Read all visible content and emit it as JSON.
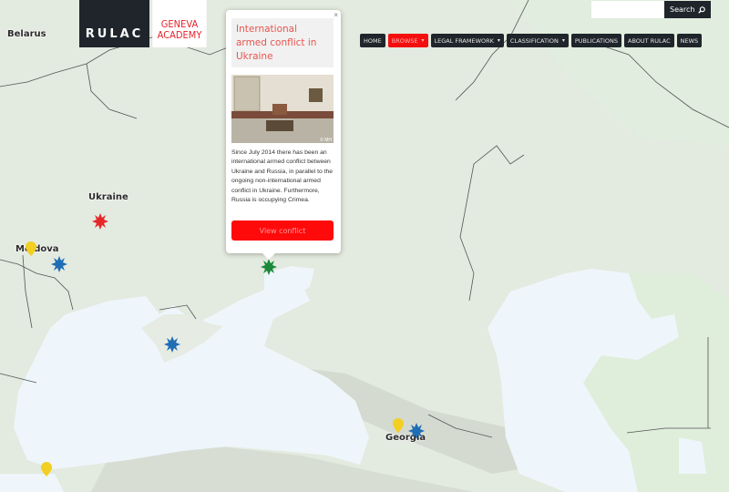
{
  "header": {
    "logo_primary": "RULAC",
    "logo_secondary_line1": "GENEVA",
    "logo_secondary_line2": "ACADEMY",
    "search": {
      "placeholder": "",
      "value": "",
      "button_label": "Search",
      "button_icon": "search-icon"
    }
  },
  "nav": {
    "items": [
      {
        "label": "HOME",
        "active": false,
        "dropdown": false
      },
      {
        "label": "BROWSE",
        "active": true,
        "dropdown": true
      },
      {
        "label": "LEGAL FRAMEWORK",
        "active": false,
        "dropdown": true
      },
      {
        "label": "CLASSIFICATION",
        "active": false,
        "dropdown": true
      },
      {
        "label": "PUBLICATIONS",
        "active": false,
        "dropdown": false
      },
      {
        "label": "ABOUT RULAC",
        "active": false,
        "dropdown": false
      },
      {
        "label": "NEWS",
        "active": false,
        "dropdown": false
      }
    ],
    "caret": "▾"
  },
  "popup": {
    "close_glyph": "×",
    "title": "International armed conflict in Ukraine",
    "image_credit": "© MH",
    "description": "Since July 2014 there has been an international armed conflict between Ukraine and Russia, in parallel to the ongoing non-international armed conflict in Ukraine. Furthermore, Russia is occupying Crimea.",
    "button_label": "View conflict"
  },
  "map": {
    "labels": [
      {
        "name": "Belarus"
      },
      {
        "name": "Ukraine"
      },
      {
        "name": "Moldova"
      },
      {
        "name": "Georgia"
      }
    ],
    "markers": [
      {
        "type": "burst",
        "color": "#e8262a",
        "meaning": "Ukraine conflict"
      },
      {
        "type": "pin",
        "color": "#f2cf22",
        "meaning": "Moldova"
      },
      {
        "type": "burst",
        "color": "#1f6db5",
        "meaning": "Transnistria"
      },
      {
        "type": "burst",
        "color": "#1a8a3a",
        "meaning": "selected IAC Ukraine"
      },
      {
        "type": "burst",
        "color": "#1f6db5",
        "meaning": "Crimea"
      },
      {
        "type": "pin",
        "color": "#f2cf22",
        "meaning": "Georgia"
      },
      {
        "type": "burst",
        "color": "#1f6db5",
        "meaning": "Georgia occupation"
      },
      {
        "type": "pin",
        "color": "#f2cf22",
        "meaning": "Turkey"
      }
    ],
    "colors": {
      "land": "#e4ebe0",
      "water": "#eff7fc",
      "border": "#555555"
    }
  }
}
